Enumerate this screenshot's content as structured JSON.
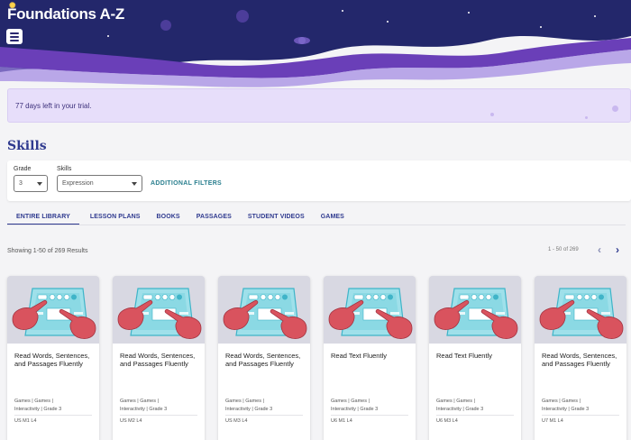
{
  "header": {
    "logo_text": "Foundations A-Z",
    "colors": {
      "navy": "#23276b",
      "purple": "#6a3fb8",
      "light_purple": "#a58be0"
    }
  },
  "trial": {
    "message": "77 days left in your trial."
  },
  "page": {
    "title": "Skills"
  },
  "filters": {
    "grade_label": "Grade",
    "grade_value": "3",
    "skills_label": "Skills",
    "skills_value": "Expression",
    "additional_label": "ADDITIONAL FILTERS"
  },
  "tabs": [
    {
      "label": "ENTIRE LIBRARY",
      "active": true
    },
    {
      "label": "LESSON PLANS"
    },
    {
      "label": "BOOKS"
    },
    {
      "label": "PASSAGES"
    },
    {
      "label": "STUDENT VIDEOS"
    },
    {
      "label": "GAMES"
    }
  ],
  "results": {
    "summary": "Showing 1-50 of 269 Results",
    "range": "1 - 50 of 269",
    "prev_icon": "chevron-left-icon",
    "next_icon": "chevron-right-icon"
  },
  "cards": [
    {
      "title": "Read Words, Sentences, and Passages Fluently",
      "tags": [
        "Games",
        "Games",
        "Interactivity",
        "Grade 3"
      ],
      "code": "US M1 L4"
    },
    {
      "title": "Read Words, Sentences, and Passages Fluently",
      "tags": [
        "Games",
        "Games",
        "Interactivity",
        "Grade 3"
      ],
      "code": "US M2 L4"
    },
    {
      "title": "Read Words, Sentences, and Passages Fluently",
      "tags": [
        "Games",
        "Games",
        "Interactivity",
        "Grade 3"
      ],
      "code": "US M3 L4"
    },
    {
      "title": "Read Text Fluently",
      "tags": [
        "Games",
        "Games",
        "Interactivity",
        "Grade 3"
      ],
      "code": "U6 M1 L4"
    },
    {
      "title": "Read Text Fluently",
      "tags": [
        "Games",
        "Games",
        "Interactivity",
        "Grade 3"
      ],
      "code": "U6 M3 L4"
    },
    {
      "title": "Read Words, Sentences, and Passages Fluently",
      "tags": [
        "Games",
        "Games",
        "Interactivity",
        "Grade 3"
      ],
      "code": "U7 M1 L4"
    }
  ]
}
